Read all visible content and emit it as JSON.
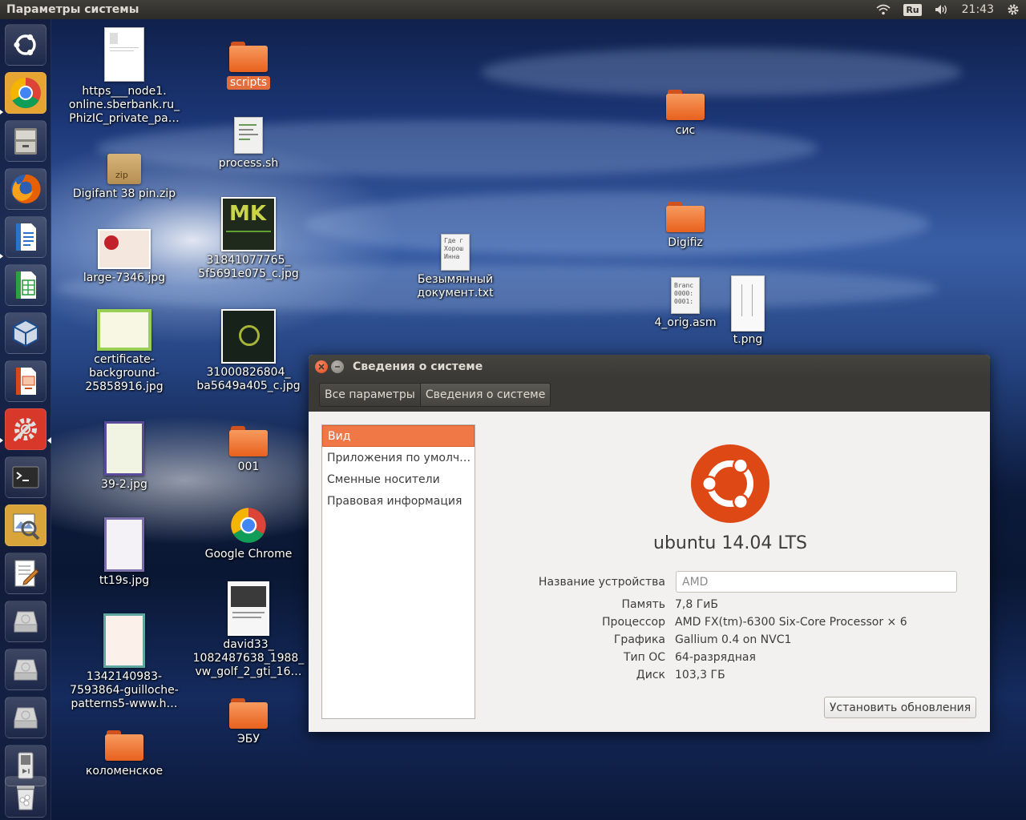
{
  "top_panel": {
    "title": "Параметры системы",
    "keyboard_layout": "Ru",
    "time": "21:43"
  },
  "launcher": {
    "items": [
      "ubuntu-dash-icon",
      "chrome-icon",
      "file-manager-icon",
      "firefox-icon",
      "writer-icon",
      "calc-icon",
      "virtualbox-icon",
      "impress-icon",
      "system-settings-icon",
      "terminal-icon",
      "image-viewer-icon",
      "text-editor-icon",
      "drive-icon",
      "drive-icon",
      "drive-icon",
      "media-player-icon",
      "trash-icon"
    ]
  },
  "desktop": {
    "icons": [
      {
        "label": "https___node1.\nonline.sberbank.ru_\nPhizIC_private_pa…"
      },
      {
        "label": "scripts"
      },
      {
        "label": "process.sh"
      },
      {
        "label": "Digifant 38 pin.zip"
      },
      {
        "label": "31841077765_\n5f5691e075_c.jpg"
      },
      {
        "label": "large-7346.jpg"
      },
      {
        "label": "certificate-\nbackground-\n25858916.jpg"
      },
      {
        "label": "31000826804_\nba5649a405_c.jpg"
      },
      {
        "label": "39-2.jpg"
      },
      {
        "label": "001"
      },
      {
        "label": "tt19s.jpg"
      },
      {
        "label": "Google Chrome"
      },
      {
        "label": "1342140983-\n7593864-guilloche-\npatterns5-www.h…"
      },
      {
        "label": "david33_\n1082487638_1988_\nvw_golf_2_gti_16…"
      },
      {
        "label": "коломенское"
      },
      {
        "label": "ЭБУ"
      },
      {
        "label": "Безымянный\nдокумент.txt"
      },
      {
        "label": "сис"
      },
      {
        "label": "Digifiz"
      },
      {
        "label": "4_orig.asm"
      },
      {
        "label": "t.png"
      }
    ],
    "file_thumb_text": {
      "txt": "Где г\nХорош\nИнна",
      "asm": "Branc\n0000:\n0001:"
    },
    "zip_badge": "zip",
    "mk_text": "MK"
  },
  "window": {
    "title": "Сведения о системе",
    "breadcrumbs": [
      "Все параметры",
      "Сведения о системе"
    ],
    "sidebar": [
      "Вид",
      "Приложения по умолч…",
      "Сменные носители",
      "Правовая информация"
    ],
    "os_name": "ubuntu 14.04 LTS",
    "device_name_label": "Название устройства",
    "device_name_value": "AMD",
    "details": [
      {
        "label": "Память",
        "value": "7,8 ГиБ"
      },
      {
        "label": "Процессор",
        "value": "AMD FX(tm)-6300 Six-Core Processor × 6"
      },
      {
        "label": "Графика",
        "value": "Gallium 0.4 on NVC1"
      },
      {
        "label": "Тип ОС",
        "value": "64-разрядная"
      },
      {
        "label": "Диск",
        "value": "103,3 ГБ"
      }
    ],
    "update_button": "Установить обновления"
  },
  "colors": {
    "accent_orange": "#f07746",
    "ubuntu_orange": "#dd4814",
    "panel_dark": "#3a3935"
  }
}
